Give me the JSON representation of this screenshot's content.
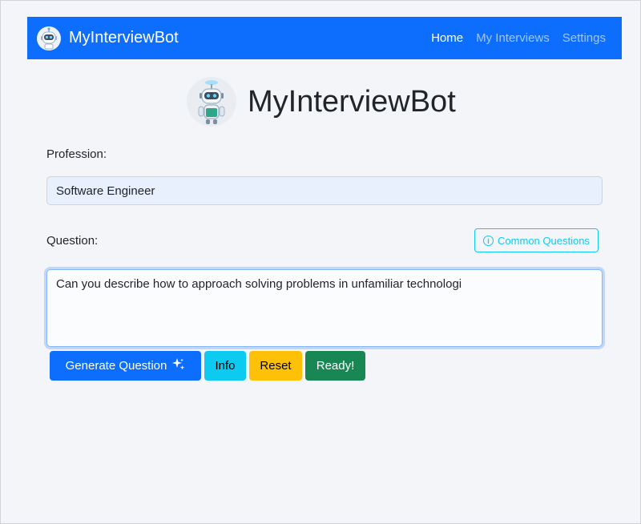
{
  "navbar": {
    "brand": "MyInterviewBot",
    "logo_icon": "robot-icon",
    "links": [
      {
        "label": "Home",
        "active": true
      },
      {
        "label": "My Interviews",
        "active": false
      },
      {
        "label": "Settings",
        "active": false
      }
    ]
  },
  "hero": {
    "title": "MyInterviewBot",
    "avatar_icon": "robot-icon"
  },
  "form": {
    "profession_label": "Profession:",
    "profession_value": "Software Engineer",
    "question_label": "Question:",
    "common_questions_label": "Common Questions",
    "question_value": "Can you describe how to approach solving problems in unfamiliar technologi"
  },
  "buttons": {
    "generate": "Generate Question",
    "info": "Info",
    "reset": "Reset",
    "ready": "Ready!"
  },
  "colors": {
    "primary": "#0d6efd",
    "info": "#0dcaf0",
    "warning": "#ffc107",
    "success": "#198754"
  }
}
